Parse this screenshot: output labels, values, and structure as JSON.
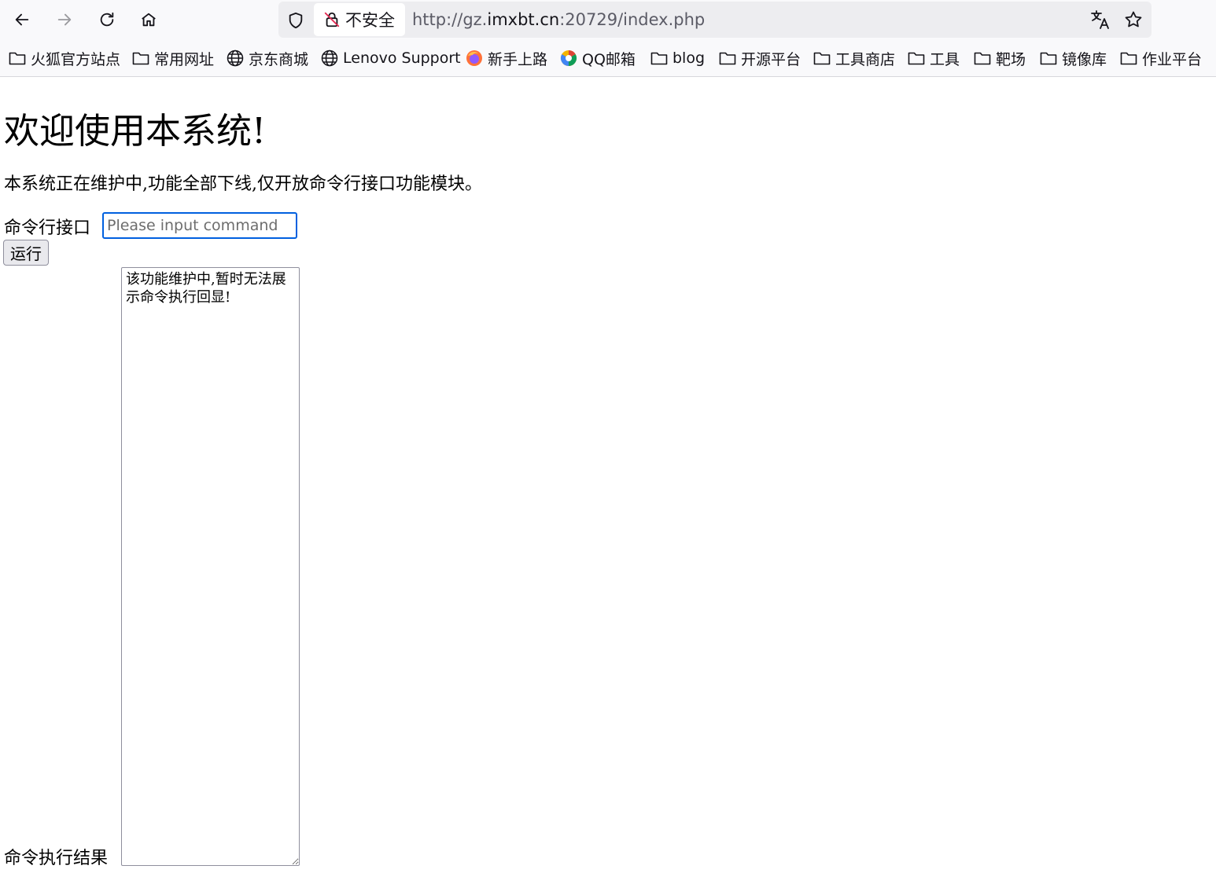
{
  "browser": {
    "security_label": "不安全",
    "url": {
      "prefix": "http://gz.",
      "host": "imxbt.cn",
      "suffix": ":20729/index.php"
    },
    "icons": {
      "back": "back-arrow-icon",
      "forward": "forward-arrow-icon",
      "reload": "reload-icon",
      "home": "home-icon",
      "tracking": "shield-icon",
      "insecure": "broken-lock-icon",
      "translate": "translate-icon",
      "bookmark": "star-icon"
    },
    "colors": {
      "focus_ring": "#0060df",
      "toolbar_bg": "#f9f9fb",
      "urlbar_bg": "#ededf0"
    }
  },
  "bookmarks": [
    {
      "label": "火狐官方站点",
      "icon": "folder-icon"
    },
    {
      "label": "常用网址",
      "icon": "folder-icon"
    },
    {
      "label": "京东商城",
      "icon": "globe-icon"
    },
    {
      "label": "Lenovo Support",
      "icon": "globe-icon"
    },
    {
      "label": "新手上路",
      "icon": "firefox-icon"
    },
    {
      "label": "QQ邮箱",
      "icon": "qq-mail-icon"
    },
    {
      "label": "blog",
      "icon": "folder-icon"
    },
    {
      "label": "开源平台",
      "icon": "folder-icon"
    },
    {
      "label": "工具商店",
      "icon": "folder-icon"
    },
    {
      "label": "工具",
      "icon": "folder-icon"
    },
    {
      "label": "靶场",
      "icon": "folder-icon"
    },
    {
      "label": "镜像库",
      "icon": "folder-icon"
    },
    {
      "label": "作业平台",
      "icon": "folder-icon"
    }
  ],
  "page": {
    "title": "欢迎使用本系统!",
    "notice": "本系统正在维护中,功能全部下线,仅开放命令行接口功能模块。",
    "command_label": "命令行接口",
    "command_placeholder": "Please input command",
    "run_label": "运行",
    "result_label": "命令执行结果",
    "result_text": "该功能维护中,暂时无法展示命令执行回显!"
  }
}
